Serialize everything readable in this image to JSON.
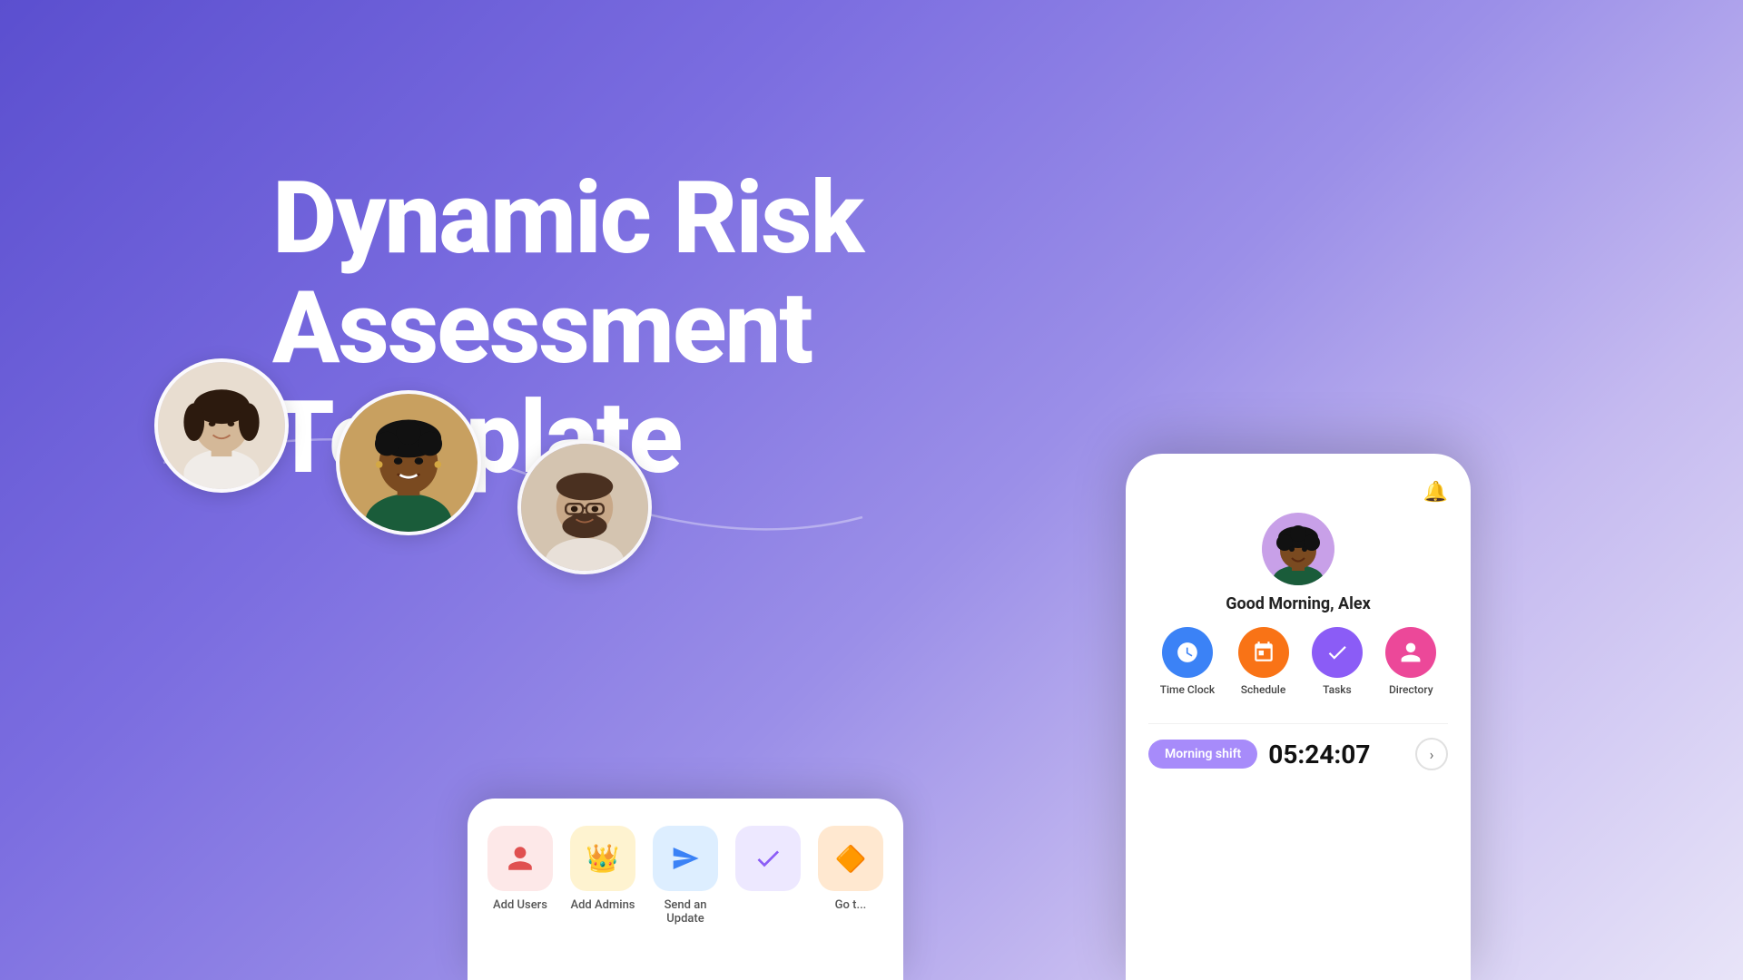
{
  "hero": {
    "title_line1": "Dynamic Risk",
    "title_line2": "Assessment Template"
  },
  "avatars": [
    {
      "id": "avatar-1",
      "emoji": "👩"
    },
    {
      "id": "avatar-2",
      "emoji": "👩🏿"
    },
    {
      "id": "avatar-3",
      "emoji": "🧔"
    }
  ],
  "app_mockup_left": {
    "icons": [
      {
        "label": "Add Users",
        "emoji": "👤",
        "color_class": "icon-pink"
      },
      {
        "label": "Add Admins",
        "emoji": "👑",
        "color_class": "icon-yellow"
      },
      {
        "label": "Send an Update",
        "emoji": "📤",
        "color_class": "icon-blue"
      },
      {
        "label": "",
        "emoji": "✅",
        "color_class": "icon-purple"
      },
      {
        "label": "Go t...",
        "emoji": "🔶",
        "color_class": "icon-orange"
      }
    ]
  },
  "phone_mockup": {
    "greeting": "Good Morning, Alex",
    "icons": [
      {
        "label": "Time Clock",
        "emoji": "⏱",
        "color_class": "pi-blue"
      },
      {
        "label": "Schedule",
        "emoji": "📅",
        "color_class": "pi-orange"
      },
      {
        "label": "Tasks",
        "emoji": "✔",
        "color_class": "pi-purple"
      },
      {
        "label": "Directory",
        "emoji": "👤",
        "color_class": "pi-pink"
      }
    ],
    "shift_label": "Morning shift",
    "shift_time": "05:24:07"
  }
}
